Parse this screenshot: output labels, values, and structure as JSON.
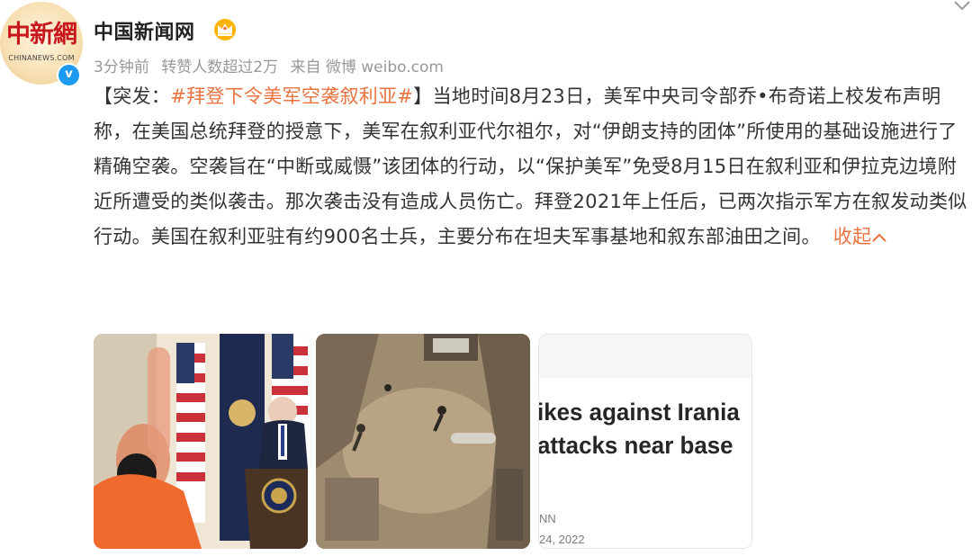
{
  "account": {
    "avatar_logo": "中新網",
    "avatar_sub": "CHINANEWS.COM",
    "name": "中国新闻网",
    "verified_mark": "v"
  },
  "meta": {
    "time": "3分钟前",
    "likes": "转赞人数超过2万",
    "source": "来自 微博 weibo.com"
  },
  "post": {
    "prefix": "【突发：",
    "topic": "#拜登下令美军空袭叙利亚#",
    "body": "】当地时间8月23日，美军中央司令部乔•布奇诺上校发布声明称，在美国总统拜登的授意下，美军在叙利亚代尔祖尔，对“伊朗支持的团体”所使用的基础设施进行了精确空袭。空袭旨在“中断或威慑”该团体的行动，以“保护美军”免受8月15日在叙利亚和伊拉克边境附近所遭受的类似袭击。那次袭击没有造成人员伤亡。拜登2021年上任后，已两次指示军方在叙发动类似行动。美国在叙利亚驻有约900名士兵，主要分布在坦夫军事基地和叙东部油田之间。",
    "collapse_label": "收起"
  },
  "thumbnails": [
    {
      "desc_icon": "press-conference-photo-icon"
    },
    {
      "desc_icon": "aerial-strike-site-photo-icon"
    },
    {
      "headline": "ikes against Irania\nattacks near base",
      "source": "NN",
      "date": "24, 2022"
    }
  ],
  "colors": {
    "accent": "#eb7340",
    "meta_gray": "#999999",
    "verified_blue": "#1d9bf0"
  }
}
